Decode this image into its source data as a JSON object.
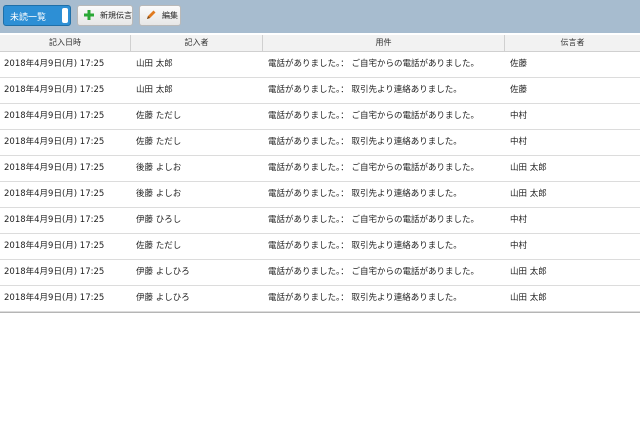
{
  "toolbar": {
    "filter_value": "未読一覧",
    "new_button_label": "新規伝言",
    "edit_button_label": "編集"
  },
  "table": {
    "columns": [
      "記入日時",
      "記入者",
      "用件",
      "伝言者"
    ],
    "rows": [
      {
        "datetime": "2018年4月9日(月) 17:25",
        "writer": "山田 太郎",
        "subject": "電話がありました。： ご自宅からの電話がありました。",
        "messenger": "佐藤"
      },
      {
        "datetime": "2018年4月9日(月) 17:25",
        "writer": "山田 太郎",
        "subject": "電話がありました。： 取引先より連絡ありました。",
        "messenger": "佐藤"
      },
      {
        "datetime": "2018年4月9日(月) 17:25",
        "writer": "佐藤 ただし",
        "subject": "電話がありました。： ご自宅からの電話がありました。",
        "messenger": "中村"
      },
      {
        "datetime": "2018年4月9日(月) 17:25",
        "writer": "佐藤 ただし",
        "subject": "電話がありました。： 取引先より連絡ありました。",
        "messenger": "中村"
      },
      {
        "datetime": "2018年4月9日(月) 17:25",
        "writer": "後藤 よしお",
        "subject": "電話がありました。： ご自宅からの電話がありました。",
        "messenger": "山田 太郎"
      },
      {
        "datetime": "2018年4月9日(月) 17:25",
        "writer": "後藤 よしお",
        "subject": "電話がありました。： 取引先より連絡ありました。",
        "messenger": "山田 太郎"
      },
      {
        "datetime": "2018年4月9日(月) 17:25",
        "writer": "伊藤 ひろし",
        "subject": "電話がありました。： ご自宅からの電話がありました。",
        "messenger": "中村"
      },
      {
        "datetime": "2018年4月9日(月) 17:25",
        "writer": "佐藤 ただし",
        "subject": "電話がありました。： 取引先より連絡ありました。",
        "messenger": "中村"
      },
      {
        "datetime": "2018年4月9日(月) 17:25",
        "writer": "伊藤 よしひろ",
        "subject": "電話がありました。： ご自宅からの電話がありました。",
        "messenger": "山田 太郎"
      },
      {
        "datetime": "2018年4月9日(月) 17:25",
        "writer": "伊藤 よしひろ",
        "subject": "電話がありました。： 取引先より連絡ありました。",
        "messenger": "山田 太郎"
      }
    ]
  },
  "icons": {
    "new": "plus-icon",
    "edit": "pencil-icon"
  },
  "colors": {
    "toolbar_bg": "#a7bccf",
    "filter_bg": "#2d8fd5",
    "plus_green": "#2aa836",
    "pencil_orange": "#e07a1f"
  }
}
